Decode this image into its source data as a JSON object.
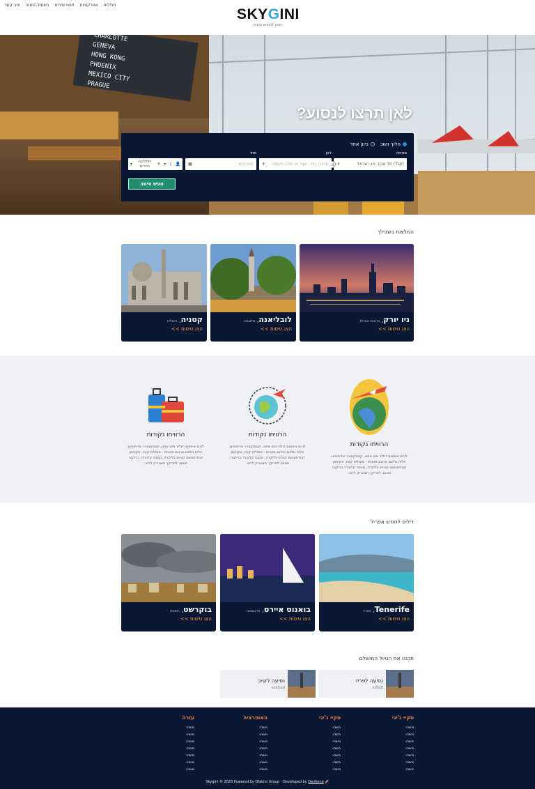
{
  "header": {
    "nav": [
      "חבילות",
      "אטרקציות",
      "תנאי שירות",
      "בשמת הזמנה",
      "צור קשר"
    ],
    "logo": {
      "main_a": "SKY",
      "main_b": "G",
      "main_c": "INI",
      "tagline": "מנוע לחיפוש טיסות"
    }
  },
  "hero": {
    "title": "לאן תרצו לנסוע?",
    "search": {
      "trip_options": [
        "הלוך ושוב",
        "כיוון אחד"
      ],
      "selected_trip": "הלוך ושוב",
      "from_label": "מאיפה",
      "from_value": "(TLV) תל אביב יפו, ישראל",
      "to_label": "לאן",
      "to_placeholder": "מדינה, עיר, אזור או שדה תעופה",
      "when_label": "מתי",
      "when_placeholder": "תאריכים",
      "passengers_value": "1",
      "class_value": "מחלקת תיירים",
      "search_button": "חפש טיסה"
    }
  },
  "recommendations": {
    "title": "המלצות בשבילך",
    "cards": [
      {
        "city": "ניו יורק",
        "country": "ארצות הברית",
        "link": "הצג טיסות >>"
      },
      {
        "city": "לובליאנה",
        "country": "סלובניה",
        "link": "הצג טיסות >>"
      },
      {
        "city": "קטניה",
        "country": "איטליה",
        "link": "הצג טיסות >>"
      }
    ]
  },
  "features": [
    {
      "title": "הרוויחו נקודות",
      "text": "לורם איפסום דולור סיט אמט, קונסקטורר אדיפיסינג אלית גולצם ארגום מאכימ - מוסליס קטיו, אקווזמן קונדימנטום קורוס בליקרה, גונסכי קלוברר בריקנה סטום, לפריקך תצטריק לרטי."
    },
    {
      "title": "הרוויחו נקודות",
      "text": "לורם איפסום דולור סיט אמט, קונסקטורר אדיפיסינג אלית גולצם ארגום מאכימ - מוסליס קטיו, אקווזמן קונדימנטום קורוס בליקרה, גונסכי קלוברר בריקנה סטום, לפריקך תצטריק לרטי."
    },
    {
      "title": "הרוויחו נקודות",
      "text": "לורם איפסום דולור סיט אמט, קונסקטורר אדיפיסינג אלית גולצם ארגום מאכימ - מוסליס קטיו, אקווזמן קונדימנטום קורוס בליקרה, גונסכי קלוברר בריקנה סטום, לפריקך תצטריק לרטי."
    }
  ],
  "deals": {
    "title": "דילים לחודש אפריל",
    "cards": [
      {
        "city": "Tenerife",
        "country": "ספרד",
        "link": "הצג טיסות >>"
      },
      {
        "city": "בואנוס איירס",
        "country": "ארגנטינה",
        "link": "הצג טיסות >>"
      },
      {
        "city": "בוקרשט",
        "country": "רומניה",
        "link": "הצג טיסות >>"
      }
    ]
  },
  "plan": {
    "title": "תכננו את הטיול המושלם",
    "items": [
      {
        "name": "נסיעה לפריז",
        "sub": "sdfsdf"
      },
      {
        "name": "נסיעה לקייב",
        "sub": "sadfsad"
      }
    ]
  },
  "footer": {
    "columns": [
      {
        "title": "סקיי ג'יני",
        "items": [
          "משהו",
          "משהו",
          "משהו",
          "משהו",
          "משהו",
          "משהו",
          "משהו"
        ]
      },
      {
        "title": "סקיי ג'יני",
        "items": [
          "משהו",
          "משהו",
          "משהו",
          "משהו",
          "משהו",
          "משהו",
          "משהו"
        ]
      },
      {
        "title": "האופרציה",
        "items": [
          "משהו",
          "משהו",
          "משהו",
          "משהו",
          "משהו",
          "משהו",
          "משהו"
        ]
      },
      {
        "title": "עזרה",
        "items": [
          "משהו",
          "משהו",
          "משהו",
          "משהו",
          "משהו",
          "משהו",
          "משהו"
        ]
      }
    ],
    "copyright": "Skygini © 2020 Powered by Ofakim Group - Developed by",
    "dev_link": "Devforce"
  },
  "colors": {
    "navy": "#0b1833",
    "accent_link": "#f4a340",
    "footer_heading": "#e9804c",
    "button": "#1f8f6e",
    "logo_blue": "#2fa6e6"
  }
}
